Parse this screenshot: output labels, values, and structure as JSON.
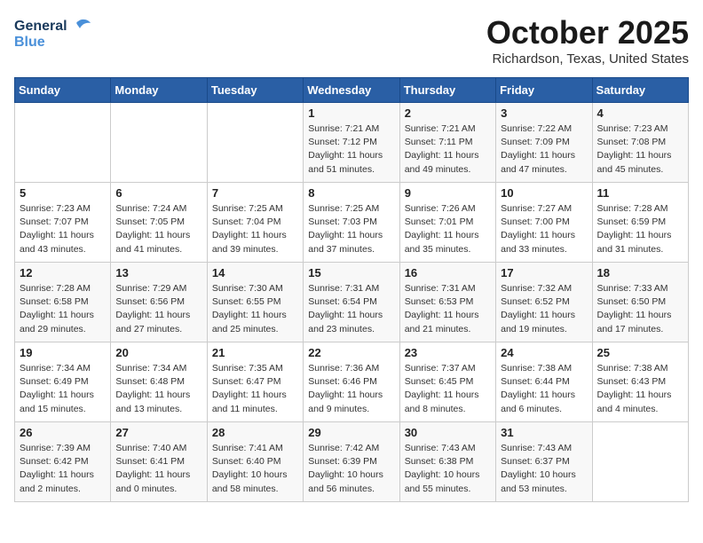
{
  "logo": {
    "line1": "General",
    "line2": "Blue"
  },
  "title": "October 2025",
  "location": "Richardson, Texas, United States",
  "days_of_week": [
    "Sunday",
    "Monday",
    "Tuesday",
    "Wednesday",
    "Thursday",
    "Friday",
    "Saturday"
  ],
  "weeks": [
    [
      {
        "day": "",
        "info": ""
      },
      {
        "day": "",
        "info": ""
      },
      {
        "day": "",
        "info": ""
      },
      {
        "day": "1",
        "info": "Sunrise: 7:21 AM\nSunset: 7:12 PM\nDaylight: 11 hours\nand 51 minutes."
      },
      {
        "day": "2",
        "info": "Sunrise: 7:21 AM\nSunset: 7:11 PM\nDaylight: 11 hours\nand 49 minutes."
      },
      {
        "day": "3",
        "info": "Sunrise: 7:22 AM\nSunset: 7:09 PM\nDaylight: 11 hours\nand 47 minutes."
      },
      {
        "day": "4",
        "info": "Sunrise: 7:23 AM\nSunset: 7:08 PM\nDaylight: 11 hours\nand 45 minutes."
      }
    ],
    [
      {
        "day": "5",
        "info": "Sunrise: 7:23 AM\nSunset: 7:07 PM\nDaylight: 11 hours\nand 43 minutes."
      },
      {
        "day": "6",
        "info": "Sunrise: 7:24 AM\nSunset: 7:05 PM\nDaylight: 11 hours\nand 41 minutes."
      },
      {
        "day": "7",
        "info": "Sunrise: 7:25 AM\nSunset: 7:04 PM\nDaylight: 11 hours\nand 39 minutes."
      },
      {
        "day": "8",
        "info": "Sunrise: 7:25 AM\nSunset: 7:03 PM\nDaylight: 11 hours\nand 37 minutes."
      },
      {
        "day": "9",
        "info": "Sunrise: 7:26 AM\nSunset: 7:01 PM\nDaylight: 11 hours\nand 35 minutes."
      },
      {
        "day": "10",
        "info": "Sunrise: 7:27 AM\nSunset: 7:00 PM\nDaylight: 11 hours\nand 33 minutes."
      },
      {
        "day": "11",
        "info": "Sunrise: 7:28 AM\nSunset: 6:59 PM\nDaylight: 11 hours\nand 31 minutes."
      }
    ],
    [
      {
        "day": "12",
        "info": "Sunrise: 7:28 AM\nSunset: 6:58 PM\nDaylight: 11 hours\nand 29 minutes."
      },
      {
        "day": "13",
        "info": "Sunrise: 7:29 AM\nSunset: 6:56 PM\nDaylight: 11 hours\nand 27 minutes."
      },
      {
        "day": "14",
        "info": "Sunrise: 7:30 AM\nSunset: 6:55 PM\nDaylight: 11 hours\nand 25 minutes."
      },
      {
        "day": "15",
        "info": "Sunrise: 7:31 AM\nSunset: 6:54 PM\nDaylight: 11 hours\nand 23 minutes."
      },
      {
        "day": "16",
        "info": "Sunrise: 7:31 AM\nSunset: 6:53 PM\nDaylight: 11 hours\nand 21 minutes."
      },
      {
        "day": "17",
        "info": "Sunrise: 7:32 AM\nSunset: 6:52 PM\nDaylight: 11 hours\nand 19 minutes."
      },
      {
        "day": "18",
        "info": "Sunrise: 7:33 AM\nSunset: 6:50 PM\nDaylight: 11 hours\nand 17 minutes."
      }
    ],
    [
      {
        "day": "19",
        "info": "Sunrise: 7:34 AM\nSunset: 6:49 PM\nDaylight: 11 hours\nand 15 minutes."
      },
      {
        "day": "20",
        "info": "Sunrise: 7:34 AM\nSunset: 6:48 PM\nDaylight: 11 hours\nand 13 minutes."
      },
      {
        "day": "21",
        "info": "Sunrise: 7:35 AM\nSunset: 6:47 PM\nDaylight: 11 hours\nand 11 minutes."
      },
      {
        "day": "22",
        "info": "Sunrise: 7:36 AM\nSunset: 6:46 PM\nDaylight: 11 hours\nand 9 minutes."
      },
      {
        "day": "23",
        "info": "Sunrise: 7:37 AM\nSunset: 6:45 PM\nDaylight: 11 hours\nand 8 minutes."
      },
      {
        "day": "24",
        "info": "Sunrise: 7:38 AM\nSunset: 6:44 PM\nDaylight: 11 hours\nand 6 minutes."
      },
      {
        "day": "25",
        "info": "Sunrise: 7:38 AM\nSunset: 6:43 PM\nDaylight: 11 hours\nand 4 minutes."
      }
    ],
    [
      {
        "day": "26",
        "info": "Sunrise: 7:39 AM\nSunset: 6:42 PM\nDaylight: 11 hours\nand 2 minutes."
      },
      {
        "day": "27",
        "info": "Sunrise: 7:40 AM\nSunset: 6:41 PM\nDaylight: 11 hours\nand 0 minutes."
      },
      {
        "day": "28",
        "info": "Sunrise: 7:41 AM\nSunset: 6:40 PM\nDaylight: 10 hours\nand 58 minutes."
      },
      {
        "day": "29",
        "info": "Sunrise: 7:42 AM\nSunset: 6:39 PM\nDaylight: 10 hours\nand 56 minutes."
      },
      {
        "day": "30",
        "info": "Sunrise: 7:43 AM\nSunset: 6:38 PM\nDaylight: 10 hours\nand 55 minutes."
      },
      {
        "day": "31",
        "info": "Sunrise: 7:43 AM\nSunset: 6:37 PM\nDaylight: 10 hours\nand 53 minutes."
      },
      {
        "day": "",
        "info": ""
      }
    ]
  ]
}
